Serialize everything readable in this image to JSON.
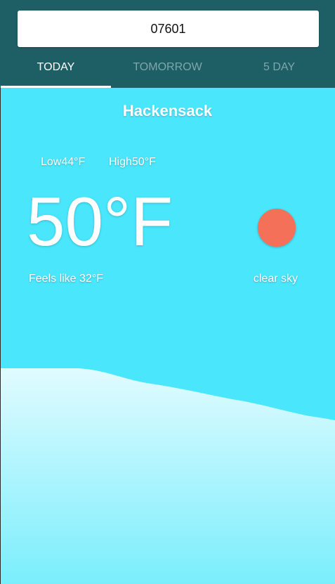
{
  "search": {
    "value": "07601"
  },
  "tabs": [
    {
      "label": "TODAY",
      "active": true
    },
    {
      "label": "TOMORROW",
      "active": false
    },
    {
      "label": "5 DAY",
      "active": false
    }
  ],
  "weather": {
    "city": "Hackensack",
    "low": "Low44°F",
    "high": "High50°F",
    "temperature": "50°F",
    "feels_like": "Feels like 32°F",
    "description": "clear sky",
    "icon": "sun-icon"
  },
  "colors": {
    "header": "#1e5f66",
    "sky": "#4ae6fc",
    "sun": "#f47058",
    "ground_top": "#e0fbff",
    "ground_bottom": "#7aeefc"
  }
}
